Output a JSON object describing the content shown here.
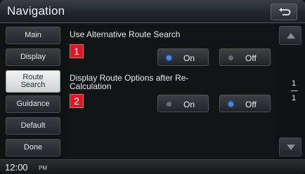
{
  "header": {
    "title": "Navigation",
    "back_icon": "back-arrow-icon"
  },
  "sidebar": {
    "items": [
      {
        "label": "Main",
        "active": false
      },
      {
        "label": "Display",
        "active": false
      },
      {
        "label": "Route Search",
        "active": true
      },
      {
        "label": "Guidance",
        "active": false
      },
      {
        "label": "Default",
        "active": false
      },
      {
        "label": "Done",
        "active": false
      }
    ]
  },
  "settings": [
    {
      "number": "1",
      "label": "Use Alternative Route Search",
      "options": [
        {
          "label": "On",
          "selected": true
        },
        {
          "label": "Off",
          "selected": false
        }
      ]
    },
    {
      "number": "2",
      "label": "Display Route Options after Re-Calculation",
      "options": [
        {
          "label": "On",
          "selected": false
        },
        {
          "label": "Off",
          "selected": true
        }
      ]
    }
  ],
  "pager": {
    "current": "1",
    "total": "1"
  },
  "status": {
    "time": "12:00",
    "ampm": "PM"
  },
  "colors": {
    "accent": "#3d8bff",
    "badge": "#d31d26"
  }
}
